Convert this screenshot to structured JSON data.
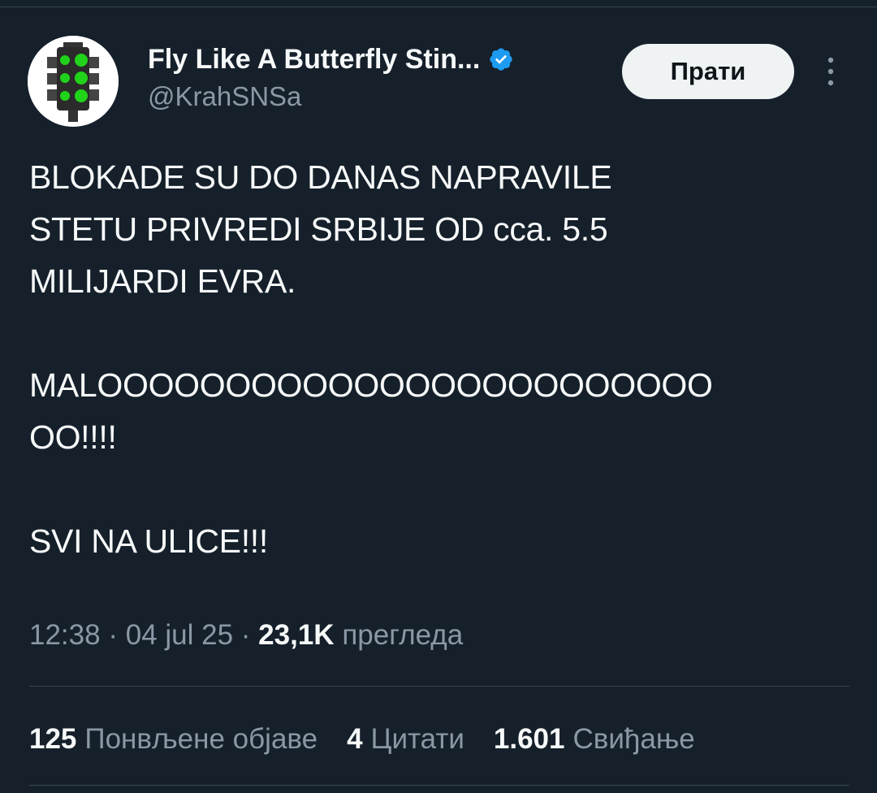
{
  "author": {
    "display_name": "Fly Like A Butterfly Stin...",
    "handle": "@KrahSNSa",
    "avatar_icon": "traffic-light-icon",
    "verified_icon": "verified-badge-icon",
    "verified_color": "#1d9bf0"
  },
  "actions": {
    "follow_label": "Прати",
    "more_icon": "more-vertical-icon"
  },
  "tweet": {
    "lines": [
      "BLOKADE SU DO DANAS NAPRAVILE",
      "STETU PRIVREDI SRBIJE OD cca. 5.5",
      "MILIJARDI EVRA.",
      "MALOOOOOOOOOOOOOOOOOOOOOOOO",
      "OO!!!!",
      "SVI NA ULICE!!!"
    ]
  },
  "meta": {
    "time": "12:38",
    "separator": "·",
    "date": "04 jul 25",
    "views_count": "23,1K",
    "views_label": "прегледа"
  },
  "stats": {
    "reposts_count": "125",
    "reposts_label": "Понвљене објаве",
    "quotes_count": "4",
    "quotes_label": "Цитати",
    "likes_count": "1.601",
    "likes_label": "Свиђање"
  },
  "colors": {
    "background": "#15202b",
    "text_primary": "#f7f9f9",
    "text_secondary": "#8b98a5",
    "divider": "#38444d",
    "button_bg": "#eff3f4"
  }
}
